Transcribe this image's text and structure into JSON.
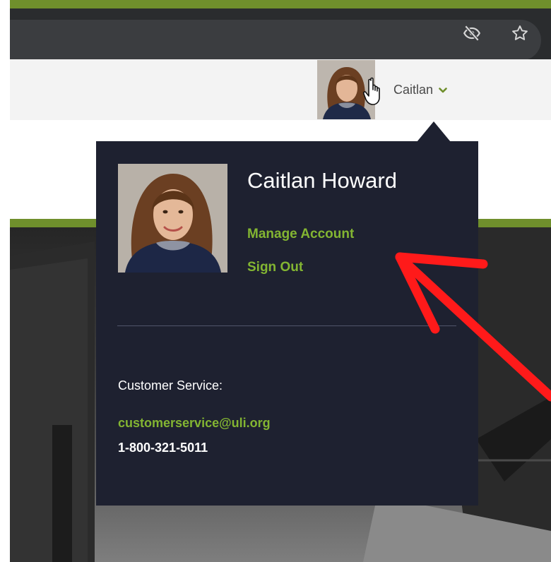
{
  "header": {
    "user_first_name": "Caitlan"
  },
  "account_menu": {
    "full_name": "Caitlan Howard",
    "manage_account_label": "Manage Account",
    "sign_out_label": "Sign Out",
    "customer_service_label": "Customer Service:",
    "customer_service_email": "customerservice@uli.org",
    "customer_service_phone": "1-800-321-5011"
  },
  "icons": {
    "address_bar": [
      "eye-slash-icon",
      "star-icon"
    ],
    "header": [
      "chevron-down-icon",
      "pointer-hand-icon"
    ]
  },
  "colors": {
    "brand_green": "#6f8f2c",
    "link_green": "#83b532",
    "menu_background": "#1e2130",
    "annotation_red": "#ff1a1a"
  }
}
